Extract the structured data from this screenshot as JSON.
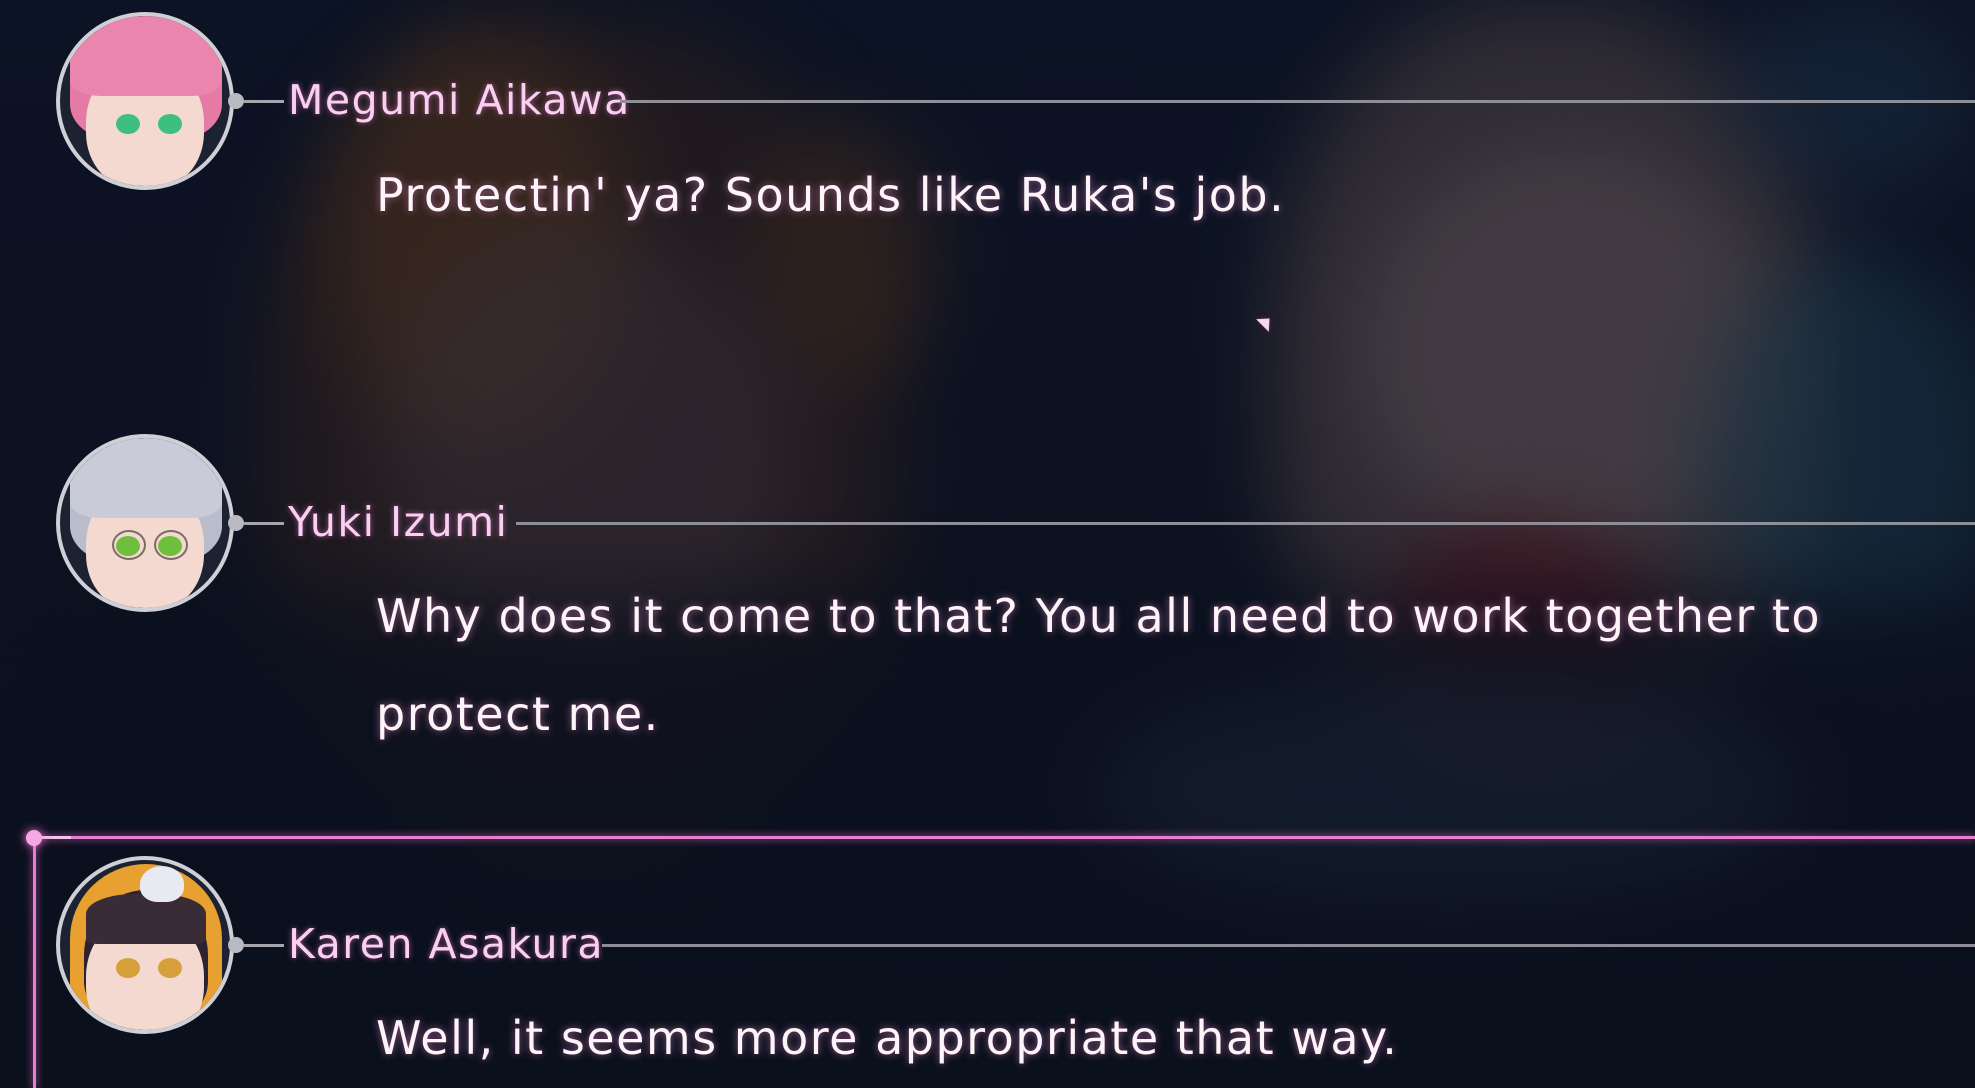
{
  "backlog": {
    "entries": [
      {
        "speaker": "Megumi Aikawa",
        "text": "Protectin' ya? Sounds like Ruka's job.",
        "portrait_icon": "megumi-portrait-icon"
      },
      {
        "speaker": "Yuki Izumi",
        "text": "Why does it come to that? You all need to work together to protect me.",
        "portrait_icon": "yuki-portrait-icon"
      },
      {
        "speaker": "Karen Asakura",
        "text": "Well, it seems more appropriate that way.",
        "portrait_icon": "karen-portrait-icon"
      }
    ]
  },
  "colors": {
    "speaker_name": "#f6d2ef",
    "dialogue_text": "#fbf4f8",
    "current_marker": "#e67fd0",
    "separator_line": "#8e8e98"
  }
}
